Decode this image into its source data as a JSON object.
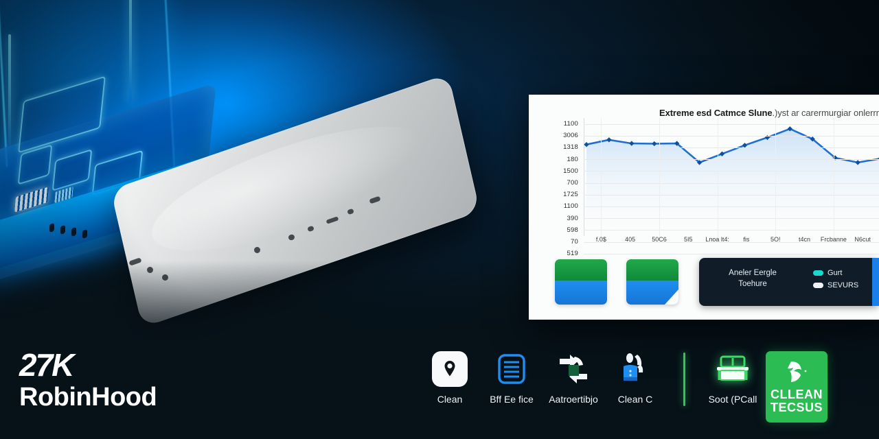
{
  "scene": {
    "background_color": "#08151c",
    "glow_color": "#0096ff",
    "devices": {
      "neon_laptop": "neon-blue-laptop",
      "silver_laptop": "closed-silver-laptop"
    }
  },
  "dashboard": {
    "panel_background": "#fbfcfc",
    "chart_title_bold": "Extreme esd Catmce Slune",
    "chart_title_light": ".)yst ar carermurgiar onlerrrob",
    "cards": [
      {
        "name": "tile-one",
        "top_color": "#15a044",
        "bottom_color": "#1a82ea"
      },
      {
        "name": "tile-two",
        "top_color": "#15a044",
        "bottom_color": "#1a82ea"
      }
    ],
    "legend_card": {
      "text_line1": "Aneler Eergle",
      "text_line2": "Toehure",
      "items": [
        {
          "label": "Gurt",
          "color": "#19d8d0"
        },
        {
          "label": "SEVURS",
          "color": "#f0f4f7"
        }
      ],
      "background": "#101d28"
    }
  },
  "chart_data": {
    "type": "line",
    "title": "Extreme esd Catmce Slune.)yst ar carermurgiar onlerrrob",
    "xlabel": "",
    "ylabel": "",
    "grid": true,
    "legend_position": "none",
    "line_color": "#1f6fd0",
    "fill_color": "#dce9f8",
    "ytick_labels": [
      "1100",
      "3006",
      "1318",
      "180",
      "1500",
      "700",
      "1725",
      "1100",
      "390",
      "598",
      "70",
      "519"
    ],
    "xtick_labels": [
      "f.0$",
      "405",
      "50C6",
      "5I5",
      "Lnoa lt4:",
      "fis",
      "5O!",
      "t4cn",
      "Frcbanne",
      "N6cut"
    ],
    "x": [
      0,
      1,
      2,
      3,
      4,
      5,
      6,
      7,
      8,
      9,
      10,
      11,
      12,
      13
    ],
    "values": [
      1045,
      1075,
      1052,
      1050,
      1052,
      930,
      985,
      1040,
      1090,
      1145,
      1080,
      960,
      930,
      955
    ],
    "ylim": [
      500,
      1175
    ]
  },
  "brand": {
    "tagline": "27K",
    "name": "RobinHood"
  },
  "icon_row": {
    "items": [
      {
        "id": "location-pin",
        "label": "Clean",
        "icon": "location-pin-icon",
        "style": "white-rounded"
      },
      {
        "id": "document-lines",
        "label": "Bff Ee fice",
        "icon": "document-icon",
        "style": "blue-outline"
      },
      {
        "id": "arrows-exchange",
        "label": "Aatroertibjo",
        "icon": "exchange-arrows-icon",
        "style": "white-green"
      },
      {
        "id": "person-cleaning",
        "label": "Clean C",
        "icon": "person-cleaning-icon",
        "style": "blue"
      },
      {
        "id": "divider",
        "label": "",
        "icon": "vertical-divider",
        "style": "divider"
      },
      {
        "id": "sofa-couch",
        "label": "Soot (PCall",
        "icon": "sofa-icon",
        "style": "green-glow"
      },
      {
        "id": "brand-tile",
        "label": "CLLEAN TECSUS",
        "icon": "leaf-logo-icon",
        "style": "green-tile"
      }
    ],
    "brand_tile": {
      "line1": "CLLEAN",
      "line2": "TECSUS",
      "background": "#2bbd54"
    }
  }
}
